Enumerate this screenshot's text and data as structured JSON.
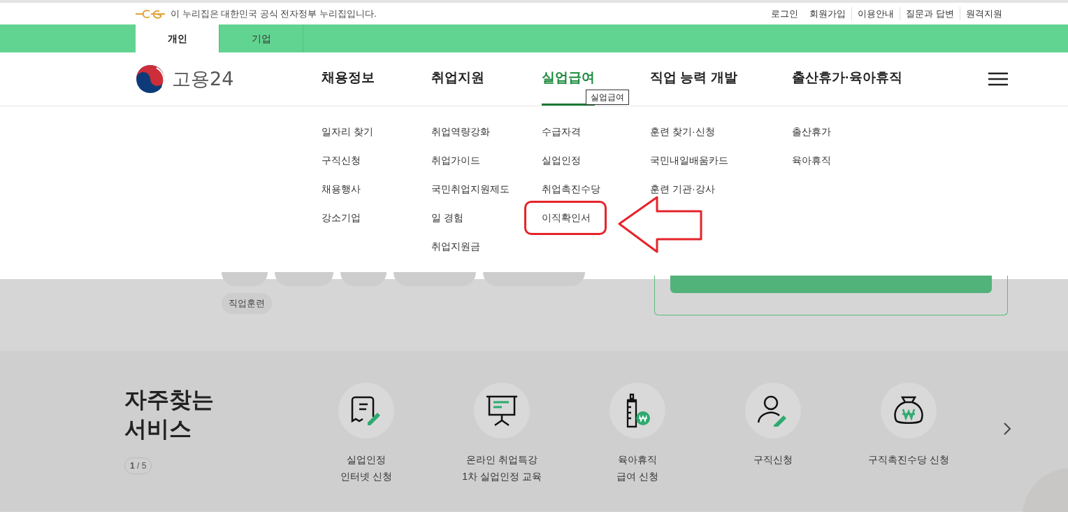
{
  "notice": {
    "text": "이 누리집은 대한민국 공식 전자정부 누리집입니다."
  },
  "utility_links": [
    "로그인",
    "회원가입",
    "이용안내",
    "질문과 답변",
    "원격지원"
  ],
  "member_tabs": [
    {
      "label": "개인",
      "selected": true
    },
    {
      "label": "기업",
      "selected": false
    }
  ],
  "logo": {
    "text": "고용24"
  },
  "main_menu": [
    {
      "label": "채용정보",
      "selected": false,
      "items": [
        {
          "label": "일자리 찾기",
          "highlighted": false
        },
        {
          "label": "구직신청",
          "highlighted": false
        },
        {
          "label": "채용행사",
          "highlighted": false
        },
        {
          "label": "강소기업",
          "highlighted": false
        }
      ]
    },
    {
      "label": "취업지원",
      "selected": false,
      "items": [
        {
          "label": "취업역량강화",
          "highlighted": false
        },
        {
          "label": "취업가이드",
          "highlighted": false
        },
        {
          "label": "국민취업지원제도",
          "highlighted": false
        },
        {
          "label": "일 경험",
          "highlighted": false
        },
        {
          "label": "취업지원금",
          "highlighted": false
        }
      ]
    },
    {
      "label": "실업급여",
      "selected": true,
      "items": [
        {
          "label": "수급자격",
          "highlighted": false
        },
        {
          "label": "실업인정",
          "highlighted": false
        },
        {
          "label": "취업촉진수당",
          "highlighted": false
        },
        {
          "label": "이직확인서",
          "highlighted": true
        }
      ]
    },
    {
      "label": "직업 능력 개발",
      "selected": false,
      "items": [
        {
          "label": "훈련 찾기·신청",
          "highlighted": false
        },
        {
          "label": "국민내일배움카드",
          "highlighted": false
        },
        {
          "label": "훈련 기관·강사",
          "highlighted": false
        }
      ]
    },
    {
      "label": "출산휴가·육아휴직",
      "selected": false,
      "items": [
        {
          "label": "출산휴가",
          "highlighted": false
        },
        {
          "label": "육아휴직",
          "highlighted": false
        }
      ]
    }
  ],
  "tooltip": {
    "text": "실업급여"
  },
  "keyword_tags": [
    "직업훈련"
  ],
  "quick_services": {
    "title_lines": [
      "자주찾는",
      "서비스"
    ],
    "pager": "**1** / 5",
    "items": [
      {
        "kind": "document-pen",
        "lines": [
          "실업인정",
          "인터넷 신청"
        ]
      },
      {
        "kind": "presentation",
        "lines": [
          "온라인 취업특강",
          "1차 실업인정 교육"
        ]
      },
      {
        "kind": "bottle-won",
        "lines": [
          "육아휴직",
          "급여 신청"
        ]
      },
      {
        "kind": "person-pen",
        "lines": [
          "구직신청"
        ]
      },
      {
        "kind": "money-bag",
        "lines": [
          "구직촉진수당 신청"
        ]
      }
    ]
  }
}
